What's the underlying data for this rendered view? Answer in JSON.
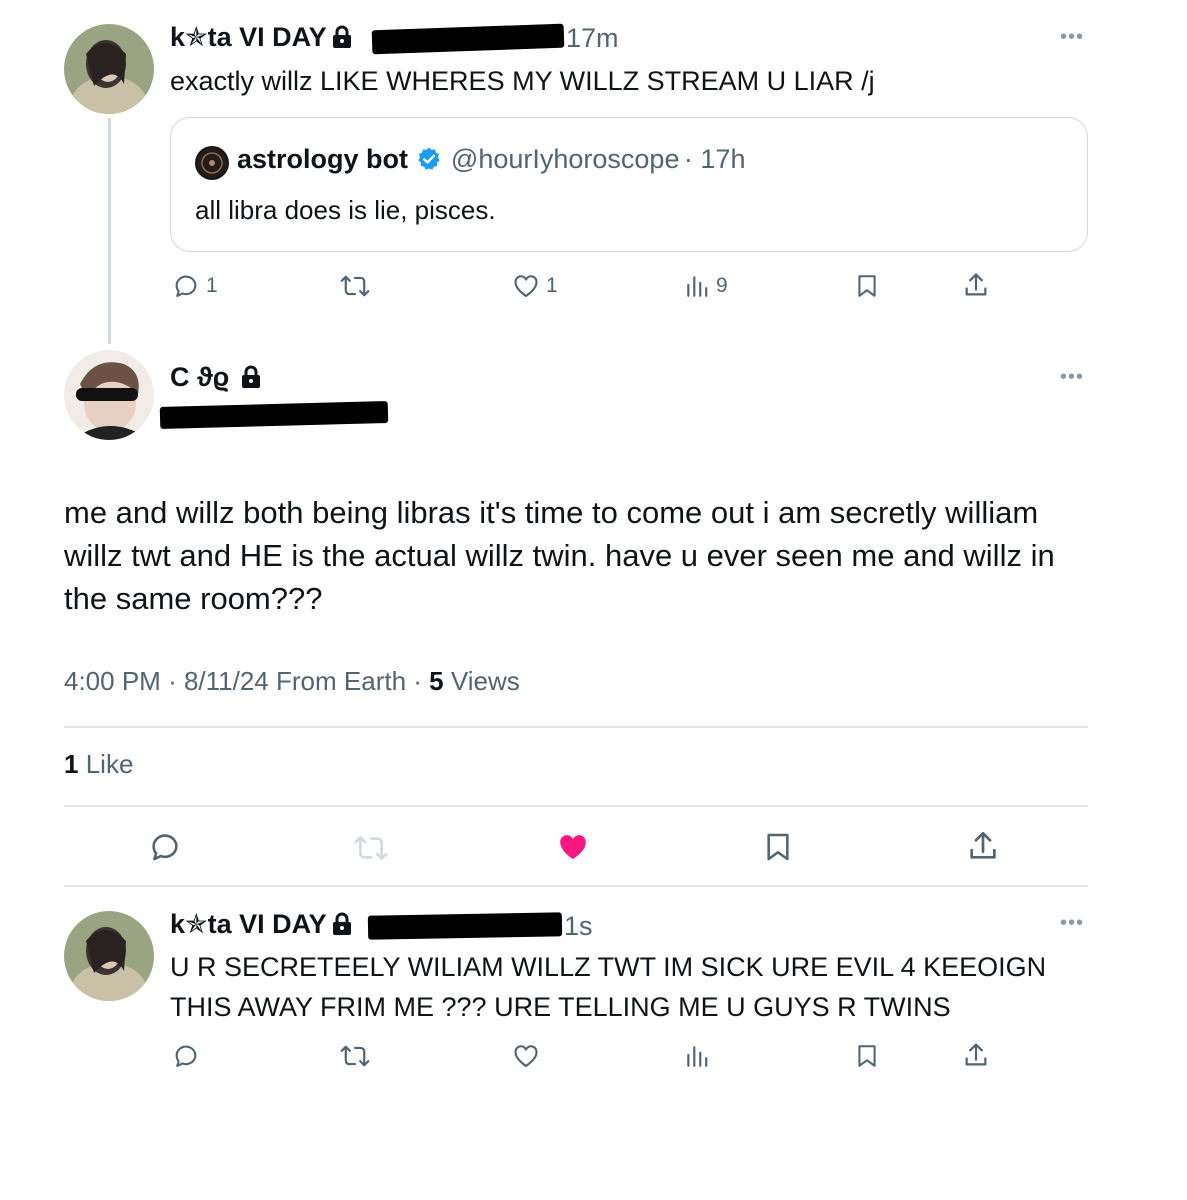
{
  "tweet1": {
    "display_name": "k✯ta VI DAY",
    "time": "17m",
    "text": "exactly willz LIKE WHERES MY WILLZ STREAM U LIAR /j",
    "quote": {
      "display_name": "astrology bot",
      "handle": "@hourIyhoroscope",
      "time": "17h",
      "text": "all libra does is lie, pisces."
    },
    "actions": {
      "reply_count": "1",
      "like_count": "1",
      "view_count": "9"
    }
  },
  "main_tweet": {
    "display_name": "C ϑϱ",
    "text_lines": [
      "me and willz both being libras it's time to come out i am secretly william",
      "willz twt and HE is the actual willz twin. have u ever seen me and willz in",
      "the same room???"
    ],
    "meta": {
      "time": "4:00 PM",
      "date": "8/11/24",
      "source": "From Earth",
      "views_count": "5",
      "views_label": "Views"
    },
    "likes": {
      "count": "1",
      "label": "Like"
    },
    "liked_color": "#f91880"
  },
  "reply": {
    "display_name": "k✯ta VI DAY",
    "time": "1s",
    "text_lines": [
      "U R SECRETEELY WILIAM WILLZ TWT IM SICK URE EVIL 4 KEEOIGN",
      "THIS AWAY FRIM ME ??? URE TELLING ME U GUYS R TWINS"
    ]
  },
  "more_glyph": "•••",
  "colors": {
    "verified": "#1d9bf0",
    "secondary_text": "#536471",
    "divider": "#e1e5e8"
  }
}
